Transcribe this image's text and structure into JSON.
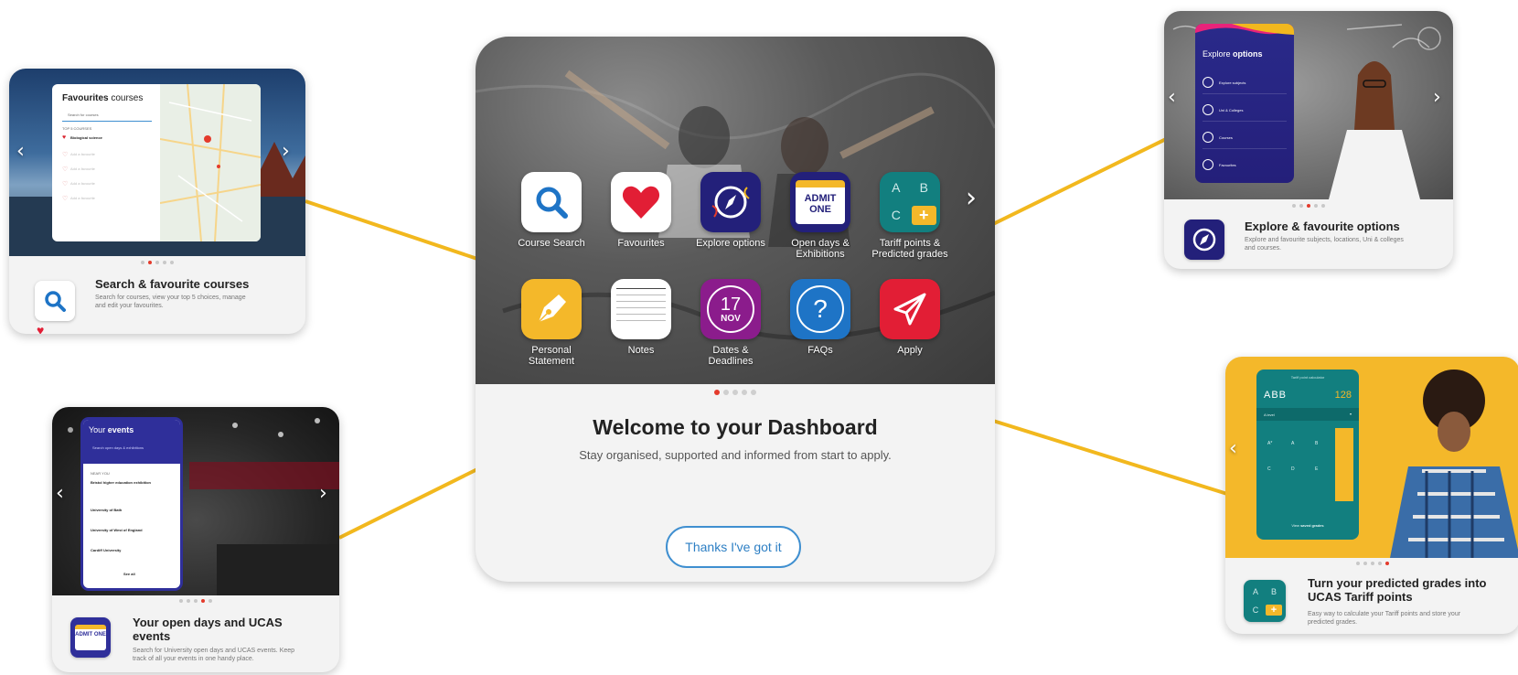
{
  "main": {
    "apps": [
      {
        "label": "Course Search",
        "icon": "search-icon"
      },
      {
        "label": "Favourites",
        "icon": "heart-icon"
      },
      {
        "label": "Explore options",
        "icon": "compass-icon"
      },
      {
        "label": "Open days & Exhibitions",
        "icon": "ticket-icon",
        "tile_text": "ADMIT ONE"
      },
      {
        "label": "Tariff points & Predicted grades",
        "icon": "grades-grid-icon",
        "tile_letters": [
          "A",
          "B",
          "C",
          "+"
        ]
      },
      {
        "label": "Personal Statement",
        "icon": "pen-nib-icon"
      },
      {
        "label": "Notes",
        "icon": "notepad-icon"
      },
      {
        "label": "Dates & Deadlines",
        "icon": "calendar-icon",
        "day": "17",
        "month": "NOV"
      },
      {
        "label": "FAQs",
        "icon": "question-icon",
        "symbol": "?"
      },
      {
        "label": "Apply",
        "icon": "paper-plane-icon"
      }
    ],
    "title": "Welcome to your Dashboard",
    "subtitle": "Stay organised, supported and informed from start to apply.",
    "button": "Thanks I've got it",
    "active_dot": 1,
    "dot_count": 5
  },
  "cards": {
    "search": {
      "title": "Search & favourite courses",
      "desc": "Search for courses, view your top 5 choices, manage and edit your favourites.",
      "screen_title_bold": "Favourites",
      "screen_title_rest": " courses",
      "search_placeholder": "Search for courses",
      "section_label": "TOP 5 COURSES",
      "first_item": "Biological science",
      "empty_item": "Add a favourite"
    },
    "events": {
      "title": "Your open days and UCAS events",
      "desc": "Search for University open days and UCAS events. Keep track of all your events in one handy place.",
      "screen_title_light": "Your ",
      "screen_title_bold": "events",
      "search_placeholder": "Search open days & exhibitions",
      "section_label": "NEAR YOU",
      "items": [
        "Bristol higher education exhibition",
        "University of Bath",
        "University of West of England",
        "Cardiff University"
      ],
      "see_all": "See all",
      "ticket_text": "ADMIT ONE"
    },
    "explore": {
      "title": "Explore & favourite options",
      "desc": "Explore and favourite subjects, locations, Uni & colleges and courses.",
      "screen_title_light": "Explore ",
      "screen_title_bold": "options",
      "items": [
        "Explore subjects",
        "Uni & Colleges",
        "Courses",
        "Favourites"
      ]
    },
    "tariff": {
      "title": "Turn your predicted grades into UCAS Tariff points",
      "desc": "Easy way to calculate your Tariff points and store your predicted grades.",
      "screen_header": "Tariff point calculator",
      "grades": "ABB",
      "points": "128",
      "level": "A level",
      "keys": [
        "A*",
        "A",
        "B",
        "C",
        "D",
        "E"
      ],
      "footer_plain": "View ",
      "footer_bold": "saved grades",
      "letters": [
        "A",
        "B",
        "C",
        "+"
      ]
    }
  },
  "colors": {
    "connector": "#f2b81e",
    "accent_red": "#e43b2c",
    "button_blue": "#2d7fc4",
    "navy": "#23207a",
    "teal": "#127f7f",
    "amber": "#f4b82a",
    "purple": "#8b1c8c"
  }
}
